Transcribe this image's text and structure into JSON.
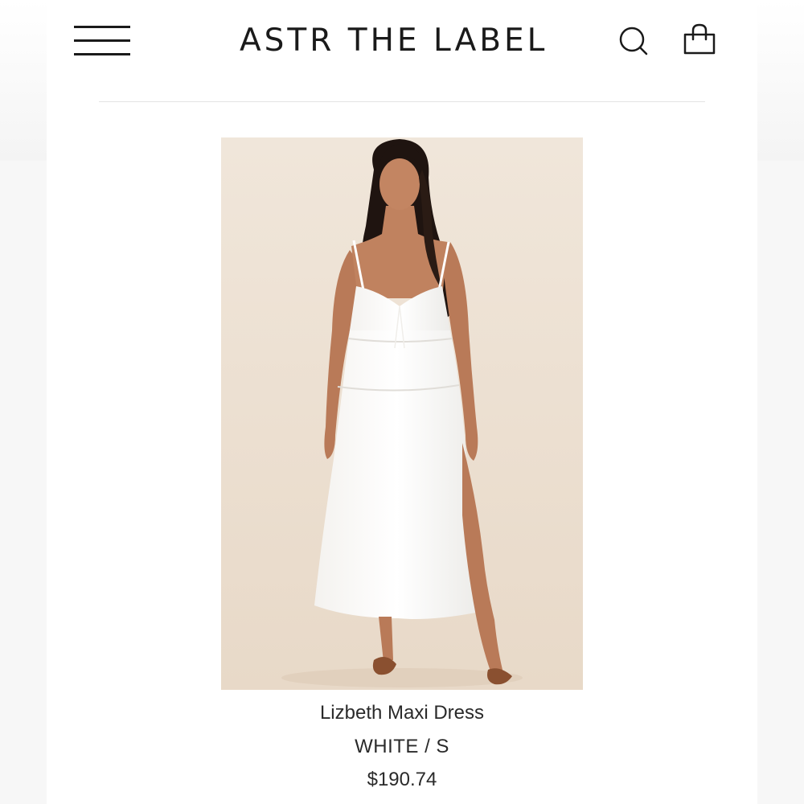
{
  "header": {
    "brand": "ASTR THE LABEL",
    "menu_icon": "hamburger-menu-icon",
    "search_icon": "search-icon",
    "cart_icon": "shopping-bag-icon"
  },
  "product": {
    "image_alt": "Model wearing white tiered maxi dress with front slit",
    "name": "Lizbeth Maxi Dress",
    "variant": "WHITE / S",
    "price": "$190.74"
  },
  "colors": {
    "text": "#1a1a1a",
    "image_background": "#ecdfd1",
    "divider": "#e4e4e4"
  }
}
